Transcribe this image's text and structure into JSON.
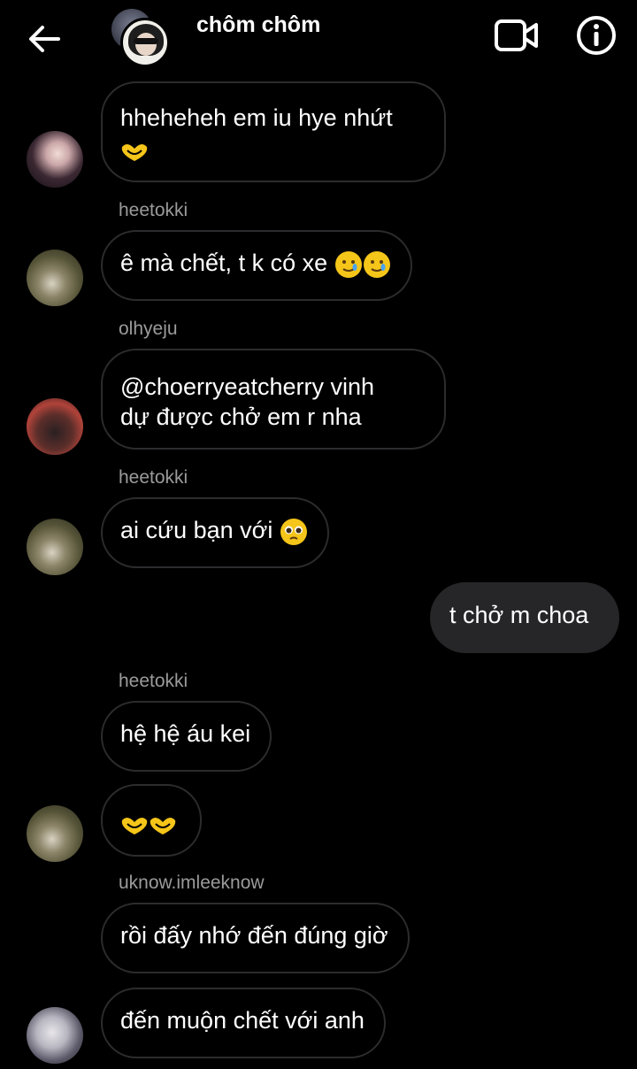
{
  "header": {
    "title": "chôm chôm"
  },
  "messages": [
    {
      "text": "hheheheh em iu hye nhứt"
    },
    {
      "sender": "heetokki",
      "text": "ê mà chết, t k có xe"
    },
    {
      "sender": "olhyeju",
      "text_line1": "@choerryeatcherry vinh",
      "text_line2": "dự được chở em r nha"
    },
    {
      "sender": "heetokki",
      "text": "ai cứu bạn với"
    },
    {
      "text": "t chở m choa"
    },
    {
      "sender": "heetokki",
      "text": "hệ hệ áu kei"
    },
    {
      "text": ""
    },
    {
      "sender": "uknow.imleeknow",
      "text": "rồi đấy nhớ đến đúng giờ"
    },
    {
      "text": "đến muộn chết với anh"
    }
  ],
  "icons": {
    "back": "arrow-left-icon",
    "video": "video-camera-icon",
    "info": "info-icon",
    "heart_hands": "heart-hands-emoji",
    "crying_smile": "smiling-with-tear-emoji",
    "pleading": "pleading-face-emoji"
  },
  "colors": {
    "background": "#000000",
    "bubble_border": "#2c2c2e",
    "outgoing_bubble": "#262628",
    "sender_text": "#9b9b9b",
    "emoji_yellow": "#f5c519"
  }
}
